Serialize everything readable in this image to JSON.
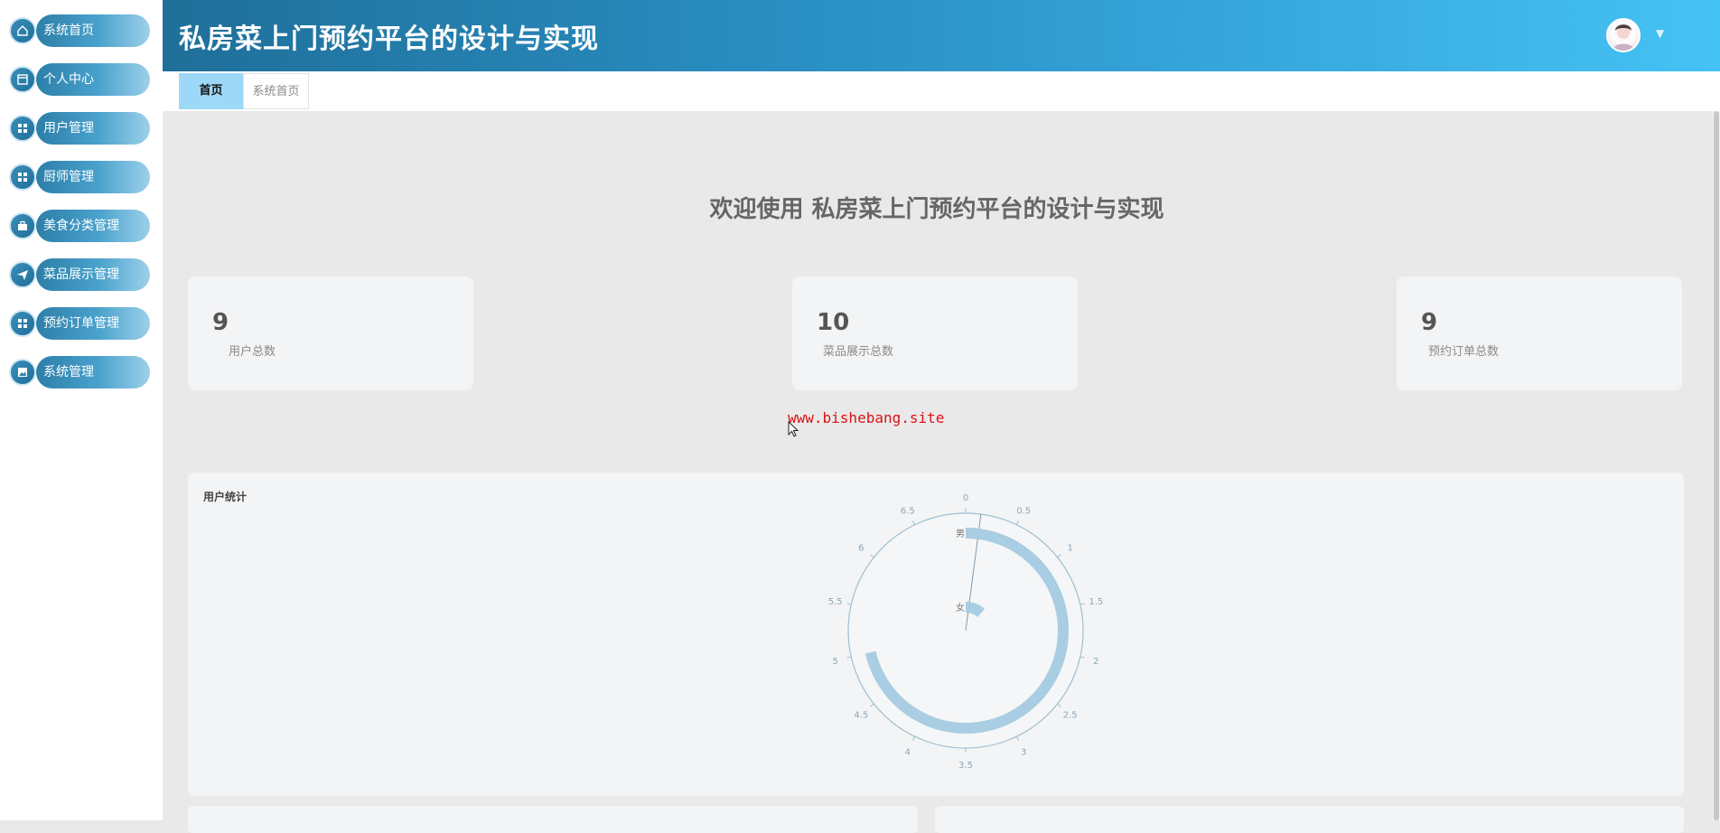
{
  "sidebar": {
    "items": [
      {
        "label": "系统首页",
        "icon": "home-icon"
      },
      {
        "label": "个人中心",
        "icon": "window-icon"
      },
      {
        "label": "用户管理",
        "icon": "grid-icon"
      },
      {
        "label": "厨师管理",
        "icon": "grid-icon"
      },
      {
        "label": "美食分类管理",
        "icon": "briefcase-icon"
      },
      {
        "label": "菜品展示管理",
        "icon": "paper-plane-icon"
      },
      {
        "label": "预约订单管理",
        "icon": "grid-icon"
      },
      {
        "label": "系统管理",
        "icon": "image-icon"
      }
    ]
  },
  "header": {
    "title": "私房菜上门预约平台的设计与实现"
  },
  "tabs": [
    {
      "label": "首页",
      "active": true
    },
    {
      "label": "系统首页",
      "active": false
    }
  ],
  "main": {
    "welcome": "欢迎使用 私房菜上门预约平台的设计与实现",
    "stats": [
      {
        "value": "9",
        "label": "用户总数"
      },
      {
        "value": "10",
        "label": "菜品展示总数"
      },
      {
        "value": "9",
        "label": "预约订单总数"
      }
    ],
    "watermark": "www.bishebang.site"
  },
  "chart_data": {
    "type": "bar",
    "polar": true,
    "title": "用户统计",
    "categories": [
      "男",
      "女"
    ],
    "values": [
      5,
      0.8
    ],
    "angle_max": 7,
    "angle_ticks": [
      "0",
      "0.5",
      "1",
      "1.5",
      "2",
      "2.5",
      "3",
      "3.5",
      "4",
      "4.5",
      "5",
      "5.5",
      "6",
      "6.5"
    ],
    "color": "#a9cde2"
  }
}
